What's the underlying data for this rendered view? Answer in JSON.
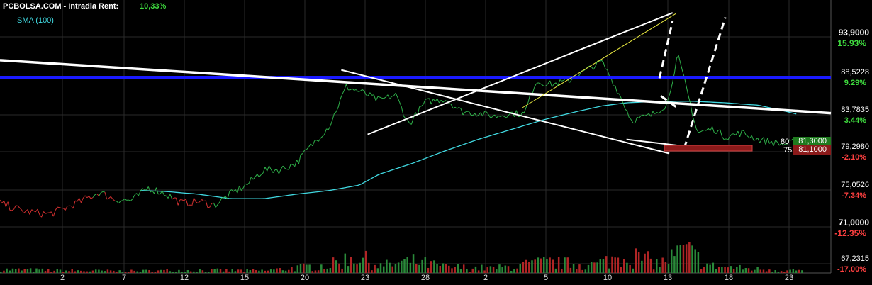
{
  "header": {
    "site": "PCBOLSA.COM - Intradia  Rent:",
    "rent": "10,33%",
    "sma_label": "SMA (100)"
  },
  "colors": {
    "background": "#000000",
    "price_up": "#2fb24a",
    "price_down": "#d23030",
    "sma": "#40d8e0",
    "support_line": "#1a1aff",
    "trendline": "#ffffff",
    "channel_line": "#e8e840",
    "bid_box": "#1e7a1e",
    "ask_box": "#8b1a1a"
  },
  "chart_data": {
    "type": "line",
    "title": "",
    "xlabel": "",
    "ylabel": "",
    "ylim": [
      67.2315,
      95.5
    ],
    "grid": true,
    "x_ticks": [
      "2",
      "7",
      "12",
      "15",
      "20",
      "23",
      "28",
      "2",
      "5",
      "10",
      "13",
      "18",
      "23"
    ],
    "y_ticks": [
      {
        "value": 93.9,
        "label": "93,9000",
        "pct": "15.93%",
        "pct_color": "#3fdc3f"
      },
      {
        "value": 88.5228,
        "label": "88,5228",
        "pct": "9.29%",
        "pct_color": "#3fdc3f"
      },
      {
        "value": 83.7835,
        "label": "83,7835",
        "pct": "3.44%",
        "pct_color": "#3fdc3f"
      },
      {
        "value": 79.298,
        "label": "79,2980",
        "pct": "-2.10%",
        "pct_color": "#ff4040"
      },
      {
        "value": 75.0526,
        "label": "75,0526",
        "pct": "-7.34%",
        "pct_color": "#ff4040"
      },
      {
        "value": 71.0,
        "label": "71,0000",
        "pct": "-12.35%",
        "pct_color": "#ff4040"
      },
      {
        "value": 67.2315,
        "label": "67,2315",
        "pct": "-17.00%",
        "pct_color": "#ff4040"
      }
    ],
    "price_anchors": [
      [
        0,
        73.6
      ],
      [
        1.5,
        72.7
      ],
      [
        3,
        72.4
      ],
      [
        4,
        73.1
      ],
      [
        5,
        73.9
      ],
      [
        6,
        74.8
      ],
      [
        7,
        74.0
      ],
      [
        8,
        73.9
      ],
      [
        9,
        75.3
      ],
      [
        10,
        74.7
      ],
      [
        11,
        73.6
      ],
      [
        12,
        73.8
      ],
      [
        13,
        73.4
      ],
      [
        14,
        74.6
      ],
      [
        15,
        75.7
      ],
      [
        16,
        77.3
      ],
      [
        17,
        77.3
      ],
      [
        18,
        78.1
      ],
      [
        19,
        80.3
      ],
      [
        20,
        82.5
      ],
      [
        21,
        87.3
      ],
      [
        22,
        86.6
      ],
      [
        23,
        85.6
      ],
      [
        24,
        86.3
      ],
      [
        24.8,
        82.6
      ],
      [
        25.8,
        85.4
      ],
      [
        27,
        85.8
      ],
      [
        28,
        84.2
      ],
      [
        29,
        84.0
      ],
      [
        30,
        83.6
      ],
      [
        31,
        84.0
      ],
      [
        31.8,
        83.9
      ],
      [
        32.5,
        88.0
      ],
      [
        33.5,
        87.6
      ],
      [
        34.5,
        88.1
      ],
      [
        35.5,
        89.4
      ],
      [
        36.5,
        90.6
      ],
      [
        37.5,
        86.7
      ],
      [
        38.3,
        83.1
      ],
      [
        39.5,
        83.7
      ],
      [
        40.5,
        85.2
      ],
      [
        41.1,
        91.5
      ],
      [
        41.7,
        86.6
      ],
      [
        42.3,
        81.6
      ],
      [
        43.3,
        82.1
      ],
      [
        44,
        81.1
      ],
      [
        45,
        81.6
      ],
      [
        46,
        80.8
      ],
      [
        47,
        80.4
      ],
      [
        47.5,
        80.2
      ],
      [
        48,
        80.4
      ],
      [
        48.6,
        80.8
      ]
    ],
    "sma_anchors": [
      [
        8.5,
        75.0
      ],
      [
        10,
        74.9
      ],
      [
        12,
        74.6
      ],
      [
        14,
        74.1
      ],
      [
        16,
        74.1
      ],
      [
        18,
        74.6
      ],
      [
        20,
        75.0
      ],
      [
        21.8,
        75.6
      ],
      [
        23,
        76.8
      ],
      [
        25,
        78.0
      ],
      [
        27,
        79.4
      ],
      [
        29,
        80.8
      ],
      [
        31,
        82.0
      ],
      [
        33,
        83.2
      ],
      [
        35,
        84.2
      ],
      [
        36.5,
        84.9
      ],
      [
        38,
        85.3
      ],
      [
        40,
        85.5
      ],
      [
        42,
        85.5
      ],
      [
        44,
        85.3
      ],
      [
        46,
        85.0
      ],
      [
        47.5,
        84.3
      ],
      [
        48.5,
        83.8
      ]
    ],
    "volume_anchors": [
      [
        0,
        0.15
      ],
      [
        4,
        0.1
      ],
      [
        8,
        0.08
      ],
      [
        12,
        0.12
      ],
      [
        16,
        0.1
      ],
      [
        20,
        0.35
      ],
      [
        21.5,
        0.75
      ],
      [
        23,
        0.3
      ],
      [
        25,
        0.5
      ],
      [
        27,
        0.25
      ],
      [
        30,
        0.2
      ],
      [
        33,
        0.45
      ],
      [
        36,
        0.35
      ],
      [
        38,
        0.8
      ],
      [
        40,
        0.4
      ],
      [
        41.5,
        1.0
      ],
      [
        43,
        0.3
      ],
      [
        45,
        0.2
      ],
      [
        48.6,
        0.1
      ]
    ],
    "support_level": 88.5228,
    "trendlines": [
      {
        "style": "solid",
        "color": "white",
        "p1": [
          0,
          90.8
        ],
        "p2": [
          50.4,
          84.0
        ]
      },
      {
        "style": "solid",
        "color": "white",
        "p1": [
          20.7,
          89.5
        ],
        "p2": [
          40.6,
          79.1
        ]
      },
      {
        "style": "solid",
        "color": "white",
        "p1": [
          22.3,
          81.4
        ],
        "p2": [
          40.8,
          97.1
        ]
      },
      {
        "style": "solid",
        "color": "yellow",
        "p1": [
          31.7,
          84.7
        ],
        "p2": [
          41.0,
          97.0
        ]
      },
      {
        "style": "dashed",
        "color": "white",
        "p1": [
          40.0,
          88.4
        ],
        "p2": [
          40.8,
          96.0
        ]
      },
      {
        "style": "dashed",
        "color": "white",
        "p1": [
          41.0,
          84.8
        ],
        "p2": [
          40.0,
          86.3
        ]
      },
      {
        "style": "dashed",
        "color": "white",
        "p1": [
          41.5,
          79.7
        ],
        "p2": [
          44.0,
          96.5
        ]
      },
      {
        "style": "solid",
        "color": "white",
        "p1": [
          38.0,
          80.8
        ],
        "p2": [
          43.5,
          79.5
        ]
      }
    ],
    "quotes": {
      "bid_qty": "80",
      "bid_price": "81,3000",
      "ask_qty": "75",
      "ask_price": "81,1000"
    }
  }
}
